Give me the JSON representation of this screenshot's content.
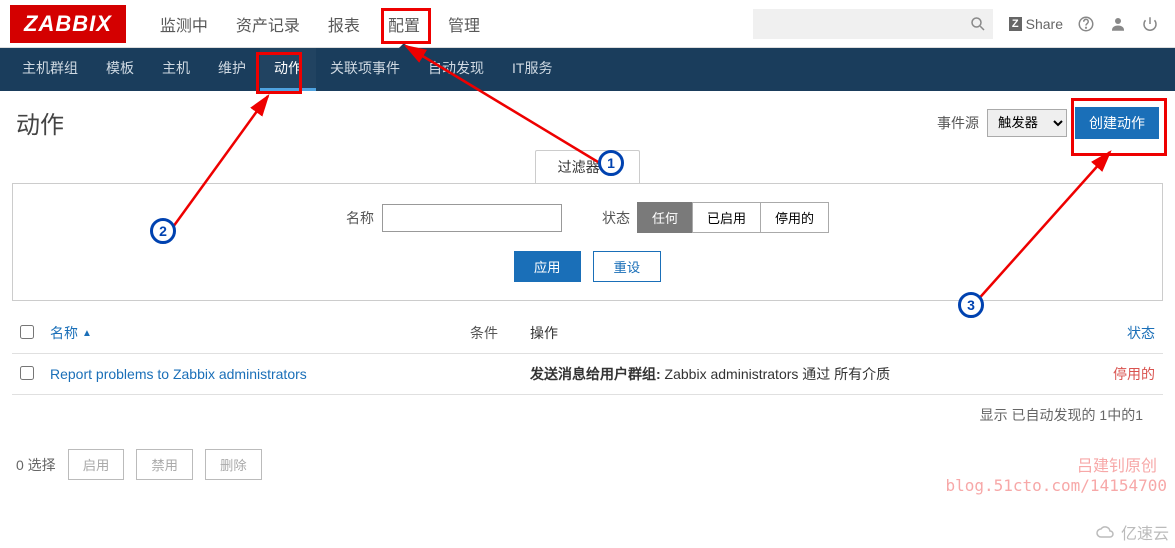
{
  "logo": "ZABBIX",
  "topnav": [
    "监测中",
    "资产记录",
    "报表",
    "配置",
    "管理"
  ],
  "topnav_active": 3,
  "share": {
    "z": "Z",
    "label": "Share"
  },
  "subnav": [
    "主机群组",
    "模板",
    "主机",
    "维护",
    "动作",
    "关联项事件",
    "自动发现",
    "IT服务"
  ],
  "subnav_active": 4,
  "search_placeholder": "",
  "page": {
    "title": "动作",
    "event_source_label": "事件源",
    "event_source_value": "触发器",
    "create_btn": "创建动作"
  },
  "filter": {
    "tab": "过滤器 ▲",
    "name_label": "名称",
    "name_value": "",
    "status_label": "状态",
    "seg": [
      "任何",
      "已启用",
      "停用的"
    ],
    "seg_active": 0,
    "apply": "应用",
    "reset": "重设"
  },
  "table": {
    "headers": {
      "name": "名称",
      "cond": "条件",
      "op": "操作",
      "status": "状态"
    },
    "sort_indicator": "▲",
    "rows": [
      {
        "name": "Report problems to Zabbix administrators",
        "op_bold": "发送消息给用户群组:",
        "op_rest": " Zabbix administrators 通过 所有介质",
        "status": "停用的"
      }
    ],
    "summary": "显示 已自动发现的 1中的1"
  },
  "footer": {
    "selected": "0 选择",
    "enable": "启用",
    "disable": "禁用",
    "delete": "删除"
  },
  "annotations": {
    "n1": "1",
    "n2": "2",
    "n3": "3"
  },
  "watermark": {
    "line1": "吕建钊原创",
    "line2": "blog.51cto.com/14154700",
    "brand": "亿速云"
  }
}
